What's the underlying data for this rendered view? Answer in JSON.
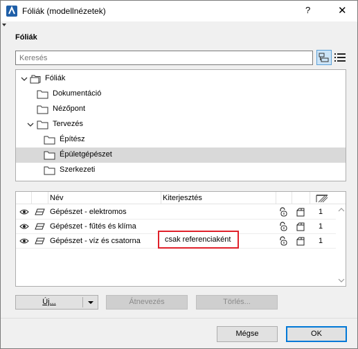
{
  "window": {
    "title": "Fóliák (modellnézetek)",
    "help_label": "?",
    "close_label": "✕"
  },
  "section_label": "Fóliák",
  "search": {
    "placeholder": "Keresés",
    "value": ""
  },
  "tree": {
    "items": [
      {
        "label": "Fóliák",
        "level": 0,
        "expanded": true,
        "selected": false
      },
      {
        "label": "Dokumentáció",
        "level": 1,
        "expanded": false,
        "selected": false
      },
      {
        "label": "Nézőpont",
        "level": 1,
        "expanded": false,
        "selected": false
      },
      {
        "label": "Tervezés",
        "level": 1,
        "expanded": true,
        "selected": false
      },
      {
        "label": "Építész",
        "level": 2,
        "expanded": false,
        "selected": false
      },
      {
        "label": "Épületgépészet",
        "level": 2,
        "expanded": false,
        "selected": true
      },
      {
        "label": "Szerkezeti",
        "level": 2,
        "expanded": false,
        "selected": false
      }
    ]
  },
  "table": {
    "columns": {
      "name": "Név",
      "extension": "Kiterjesztés"
    },
    "rows": [
      {
        "name": "Gépészet - elektromos",
        "extension": "",
        "count": "1"
      },
      {
        "name": "Gépészet - fűtés és klíma",
        "extension": "",
        "count": "1"
      },
      {
        "name": "Gépészet - víz és csatorna",
        "extension": "csak referenciaként",
        "count": "1"
      }
    ]
  },
  "buttons": {
    "new": "Új...",
    "rename": "Átnevezés",
    "delete": "Törlés...",
    "cancel": "Mégse",
    "ok": "OK"
  },
  "colors": {
    "highlight_border": "#e0202a",
    "selection": "#d9d9d9",
    "ok_border": "#0078d7",
    "app_icon": "#1f5fa8"
  }
}
